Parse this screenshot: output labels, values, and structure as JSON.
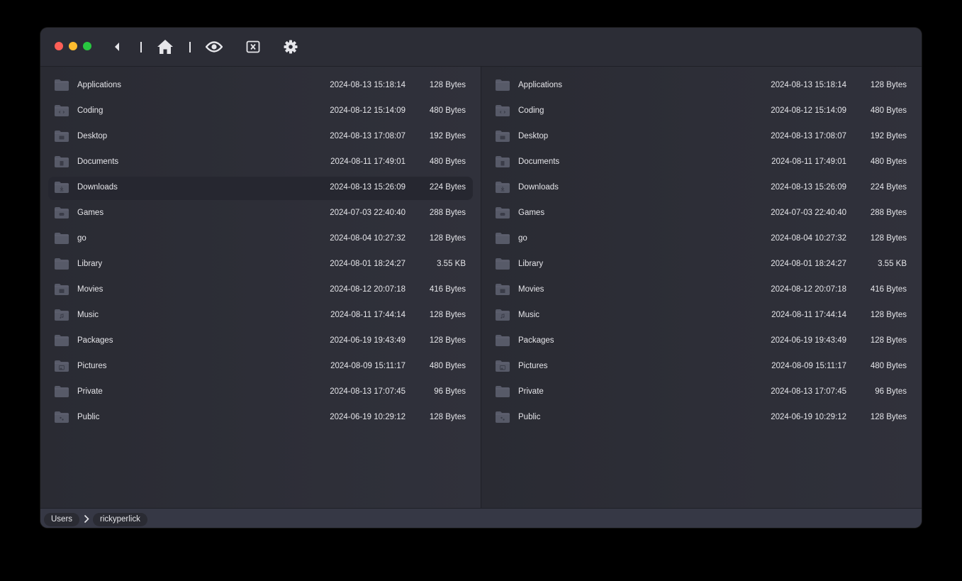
{
  "toolbar": {
    "back_icon": "caret-left-icon",
    "home_icon": "home-icon",
    "eye_icon": "eye-icon",
    "close_tab_icon": "close-box-icon",
    "settings_icon": "gear-icon"
  },
  "colors": {
    "window_bg": "#2b2c35",
    "row_selected": "#262730",
    "folder": "#575a68",
    "text": "#e6e6ea"
  },
  "left_pane": {
    "selected_index": 4,
    "items": [
      {
        "name": "Applications",
        "date": "2024-08-13 15:18:14",
        "size": "128 Bytes",
        "icon": "folder-icon"
      },
      {
        "name": "Coding",
        "date": "2024-08-12 15:14:09",
        "size": "480 Bytes",
        "icon": "code-folder-icon"
      },
      {
        "name": "Desktop",
        "date": "2024-08-13 17:08:07",
        "size": "192 Bytes",
        "icon": "desktop-folder-icon"
      },
      {
        "name": "Documents",
        "date": "2024-08-11 17:49:01",
        "size": "480 Bytes",
        "icon": "document-folder-icon"
      },
      {
        "name": "Downloads",
        "date": "2024-08-13 15:26:09",
        "size": "224 Bytes",
        "icon": "download-folder-icon"
      },
      {
        "name": "Games",
        "date": "2024-07-03 22:40:40",
        "size": "288 Bytes",
        "icon": "gamepad-folder-icon"
      },
      {
        "name": "go",
        "date": "2024-08-04 10:27:32",
        "size": "128 Bytes",
        "icon": "folder-icon"
      },
      {
        "name": "Library",
        "date": "2024-08-01 18:24:27",
        "size": "3.55 KB",
        "icon": "folder-icon"
      },
      {
        "name": "Movies",
        "date": "2024-08-12 20:07:18",
        "size": "416 Bytes",
        "icon": "movie-folder-icon"
      },
      {
        "name": "Music",
        "date": "2024-08-11 17:44:14",
        "size": "128 Bytes",
        "icon": "music-folder-icon"
      },
      {
        "name": "Packages",
        "date": "2024-06-19 19:43:49",
        "size": "128 Bytes",
        "icon": "folder-icon"
      },
      {
        "name": "Pictures",
        "date": "2024-08-09 15:11:17",
        "size": "480 Bytes",
        "icon": "picture-folder-icon"
      },
      {
        "name": "Private",
        "date": "2024-08-13 17:07:45",
        "size": "96 Bytes",
        "icon": "folder-icon"
      },
      {
        "name": "Public",
        "date": "2024-06-19 10:29:12",
        "size": "128 Bytes",
        "icon": "public-folder-icon"
      }
    ]
  },
  "right_pane": {
    "selected_index": -1,
    "items": [
      {
        "name": "Applications",
        "date": "2024-08-13 15:18:14",
        "size": "128 Bytes",
        "icon": "folder-icon"
      },
      {
        "name": "Coding",
        "date": "2024-08-12 15:14:09",
        "size": "480 Bytes",
        "icon": "code-folder-icon"
      },
      {
        "name": "Desktop",
        "date": "2024-08-13 17:08:07",
        "size": "192 Bytes",
        "icon": "desktop-folder-icon"
      },
      {
        "name": "Documents",
        "date": "2024-08-11 17:49:01",
        "size": "480 Bytes",
        "icon": "document-folder-icon"
      },
      {
        "name": "Downloads",
        "date": "2024-08-13 15:26:09",
        "size": "224 Bytes",
        "icon": "download-folder-icon"
      },
      {
        "name": "Games",
        "date": "2024-07-03 22:40:40",
        "size": "288 Bytes",
        "icon": "gamepad-folder-icon"
      },
      {
        "name": "go",
        "date": "2024-08-04 10:27:32",
        "size": "128 Bytes",
        "icon": "folder-icon"
      },
      {
        "name": "Library",
        "date": "2024-08-01 18:24:27",
        "size": "3.55 KB",
        "icon": "folder-icon"
      },
      {
        "name": "Movies",
        "date": "2024-08-12 20:07:18",
        "size": "416 Bytes",
        "icon": "movie-folder-icon"
      },
      {
        "name": "Music",
        "date": "2024-08-11 17:44:14",
        "size": "128 Bytes",
        "icon": "music-folder-icon"
      },
      {
        "name": "Packages",
        "date": "2024-06-19 19:43:49",
        "size": "128 Bytes",
        "icon": "folder-icon"
      },
      {
        "name": "Pictures",
        "date": "2024-08-09 15:11:17",
        "size": "480 Bytes",
        "icon": "picture-folder-icon"
      },
      {
        "name": "Private",
        "date": "2024-08-13 17:07:45",
        "size": "96 Bytes",
        "icon": "folder-icon"
      },
      {
        "name": "Public",
        "date": "2024-06-19 10:29:12",
        "size": "128 Bytes",
        "icon": "public-folder-icon"
      }
    ]
  },
  "breadcrumb": {
    "items": [
      "Users",
      "rickyperlick"
    ],
    "separator_icon": "chevron-right-icon"
  }
}
